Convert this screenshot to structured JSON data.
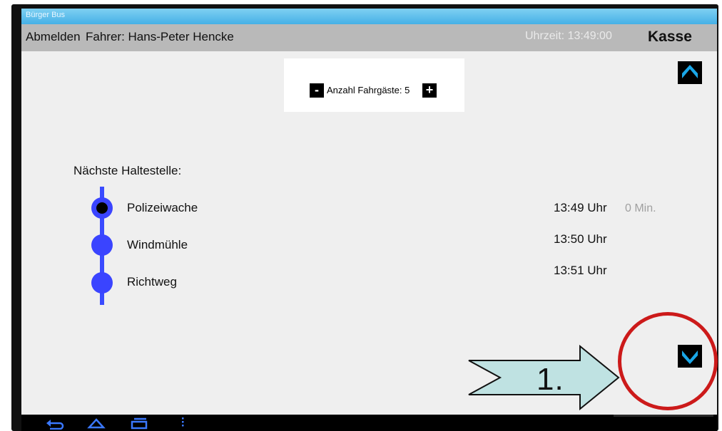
{
  "window": {
    "title": "Bürger Bus"
  },
  "header": {
    "logout_label": "Abmelden",
    "driver_label": "Fahrer: Hans-Peter Hencke",
    "clock_label": "Uhrzeit: 13:49:00",
    "cash_label": "Kasse"
  },
  "passengers": {
    "label": "Anzahl Fahrgäste: 5",
    "minus": "-",
    "plus": "+"
  },
  "next_stop_heading": "Nächste Haltestelle:",
  "stops": [
    {
      "name": "Polizeiwache",
      "time": "13:49 Uhr",
      "minutes": "0 Min.",
      "current": true
    },
    {
      "name": "Windmühle",
      "time": "13:50 Uhr",
      "minutes": ""
    },
    {
      "name": "Richtweg",
      "time": "13:51 Uhr",
      "minutes": ""
    }
  ],
  "scroll": {
    "up_icon": "chevron-up-icon",
    "down_icon": "chevron-down-icon"
  },
  "annotation": {
    "step_label": "1."
  },
  "android_nav": {
    "icons": [
      "back-icon",
      "home-icon",
      "recent-apps-icon",
      "menu-icon"
    ]
  },
  "colors": {
    "titlebar": "#45b0e6",
    "accent_blue": "#3a44ff",
    "scroll_button_icon": "#1aa7e8",
    "annotation_arrow_fill": "#bfe2e2",
    "annotation_circle": "#cc1a1a"
  }
}
